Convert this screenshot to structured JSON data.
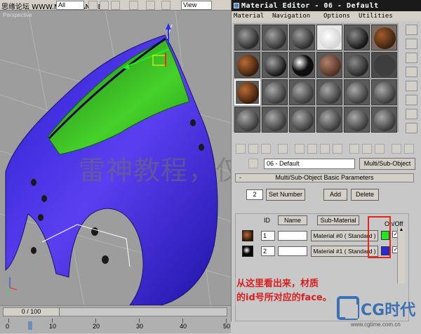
{
  "topbar": {
    "site_text": "思缘论坛 WWW.MISSYUAN.NET",
    "filter_value": "All",
    "view_value": "View"
  },
  "viewport": {
    "label": "Perspective"
  },
  "material_editor": {
    "title": "Material Editor - 06 - Default",
    "menu": [
      "Material",
      "Navigation",
      "Options",
      "Utilities"
    ],
    "material_name": "06 - Default",
    "material_type": "Multi/Sub-Object",
    "rollout_title": "Multi/Sub-Object Basic Parameters",
    "rollout_sign": "-",
    "count_value": "2",
    "set_number_label": "Set Number",
    "add_label": "Add",
    "delete_label": "Delete",
    "headers": {
      "id": "ID",
      "name": "Name",
      "sub_material": "Sub-Material",
      "on_off": "On/Off"
    },
    "rows": [
      {
        "id": "1",
        "name": "",
        "material": "Material #0  ( Standard )",
        "color": "#22e622",
        "enabled": true
      },
      {
        "id": "2",
        "name": "",
        "material": "Material #1  ( Standard )",
        "color": "#2b2bd6",
        "enabled": true
      }
    ]
  },
  "annotation": {
    "line1": "从这里看出来，材质",
    "line2": "的id号所对应的face。"
  },
  "timebar": {
    "slider_text": "0 / 100",
    "ticks": [
      "0",
      "10",
      "20",
      "30",
      "40",
      "50"
    ]
  },
  "watermark": {
    "text": "雷神教程，仅供学习"
  },
  "logo": {
    "name": "CG时代",
    "url": "www.cgtime.com.cn"
  },
  "colors": {
    "sub_material_1": "#22e622",
    "sub_material_2": "#2b2bd6",
    "highlight": "#e8251c",
    "annotation_text": "#d81e1e"
  }
}
